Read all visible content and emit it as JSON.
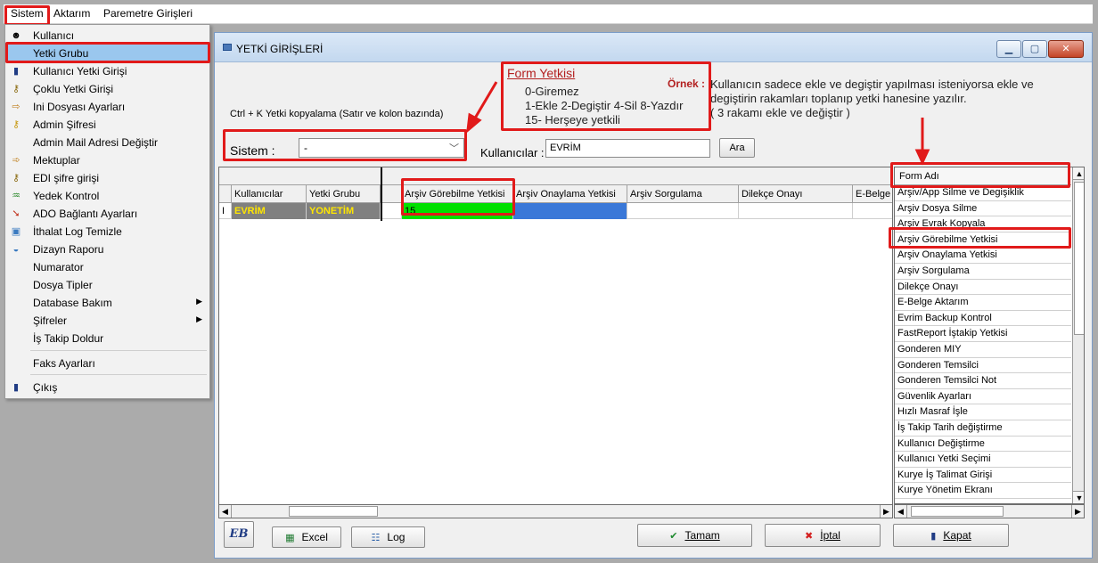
{
  "menubar": {
    "items": [
      "Sistem",
      "Aktarım",
      "Paremetre Girişleri"
    ]
  },
  "sistem_menu": {
    "items": [
      {
        "label": "Kullanıcı",
        "icon": "user-icon"
      },
      {
        "label": "Yetki Grubu",
        "icon": "",
        "selected": true
      },
      {
        "label": "Kullanıcı Yetki Girişi",
        "icon": "user-key-icon"
      },
      {
        "label": "Çoklu Yetki Girişi",
        "icon": "keys-icon"
      },
      {
        "label": "Ini Dosyası  Ayarları",
        "icon": "ini-file-icon"
      },
      {
        "label": "Admin Şifresi",
        "icon": "key-icon"
      },
      {
        "label": "Admin Mail Adresi Değiştir",
        "icon": ""
      },
      {
        "label": "Mektuplar",
        "icon": "letter-icon"
      },
      {
        "label": "EDI şifre girişi",
        "icon": "key-icon"
      },
      {
        "label": "Yedek Kontrol",
        "icon": "backup-icon"
      },
      {
        "label": "ADO Bağlantı Ayarları",
        "icon": "connection-icon"
      },
      {
        "label": "İthalat Log Temizle",
        "icon": "clean-icon"
      },
      {
        "label": "Dizayn Raporu",
        "icon": "report-icon"
      },
      {
        "label": "Numarator",
        "icon": ""
      },
      {
        "label": "Dosya Tipler",
        "icon": ""
      },
      {
        "label": "Database Bakım",
        "icon": "",
        "submenu": true
      },
      {
        "label": "Şifreler",
        "icon": "",
        "submenu": true
      },
      {
        "label": "İş Takip Doldur",
        "icon": ""
      },
      {
        "label": "Faks Ayarları",
        "icon": ""
      },
      {
        "label": "Çıkış",
        "icon": "exit-icon"
      }
    ]
  },
  "window": {
    "title": "YETKİ GİRİŞLERİ"
  },
  "form_yetkisi": {
    "title": "Form Yetkisi",
    "lines": [
      "0-Giremez",
      "1-Ekle  2-Degiştir  4-Sil  8-Yazdır",
      "15- Herşeye yetkili"
    ]
  },
  "ornek": {
    "label": "Örnek :",
    "lines": [
      "Kullanıcın sadece ekle ve degiştir yapılması isteniyorsa  ekle ve",
      "degiştirin rakamları toplanıp yetki hanesine yazılır.",
      " ( 3 rakamı ekle ve değiştir )"
    ]
  },
  "ctrl_note": "Ctrl + K Yetki kopyalama (Satır ve kolon bazında)",
  "filters": {
    "sistem_label": "Sistem :",
    "sistem_value": "-",
    "kullanicilar_label": "Kullanıcılar :",
    "kullanicilar_value": "EVRİM",
    "ara_label": "Ara"
  },
  "grid": {
    "columns": [
      "Kullanıcılar",
      "Yetki Grubu",
      "Arşiv Görebilme Yetkisi",
      "Arşiv Onaylama Yetkisi",
      "Arşiv Sorgulama",
      "Dilekçe Onayı",
      "E-Belge"
    ],
    "row": {
      "indicator": "I",
      "kullanici": "EVRİM",
      "yetki_grubu": "YONETİM",
      "arsiv_gorebilme": "15"
    }
  },
  "form_list": {
    "header": "Form Adı",
    "items": [
      "Arşiv/App Silme ve Degişiklik",
      "Arşiv Dosya Silme",
      "Arşiv Evrak Kopyala",
      "Arşiv Görebilme Yetkisi",
      "Arşiv Onaylama Yetkisi",
      "Arşiv Sorgulama",
      "Dilekçe Onayı",
      "E-Belge Aktarım",
      "Evrim Backup Kontrol",
      "FastReport İştakip Yetkisi",
      "Gonderen MIY",
      "Gonderen Temsilci",
      "Gonderen Temsilci Not",
      "Güvenlik Ayarları",
      "Hızlı Masraf İşle",
      "İş Takip Tarih değiştirme",
      "Kullanıcı Değiştirme",
      "Kullanıcı Yetki Seçimi",
      "Kurye İş Talimat Girişi",
      "Kurye Yönetim Ekranı"
    ]
  },
  "buttons": {
    "logo": "EB",
    "excel": "Excel",
    "log": "Log",
    "tamam": "Tamam",
    "iptal": "İptal",
    "kapat": "Kapat"
  },
  "colors": {
    "highlight_red": "#e11a1a",
    "menu_selected": "#9ac7ee",
    "row_user_bg": "#808080",
    "row_user_text": "#ffe600",
    "cell_green": "#00e000",
    "cell_blue": "#3a78d8"
  }
}
